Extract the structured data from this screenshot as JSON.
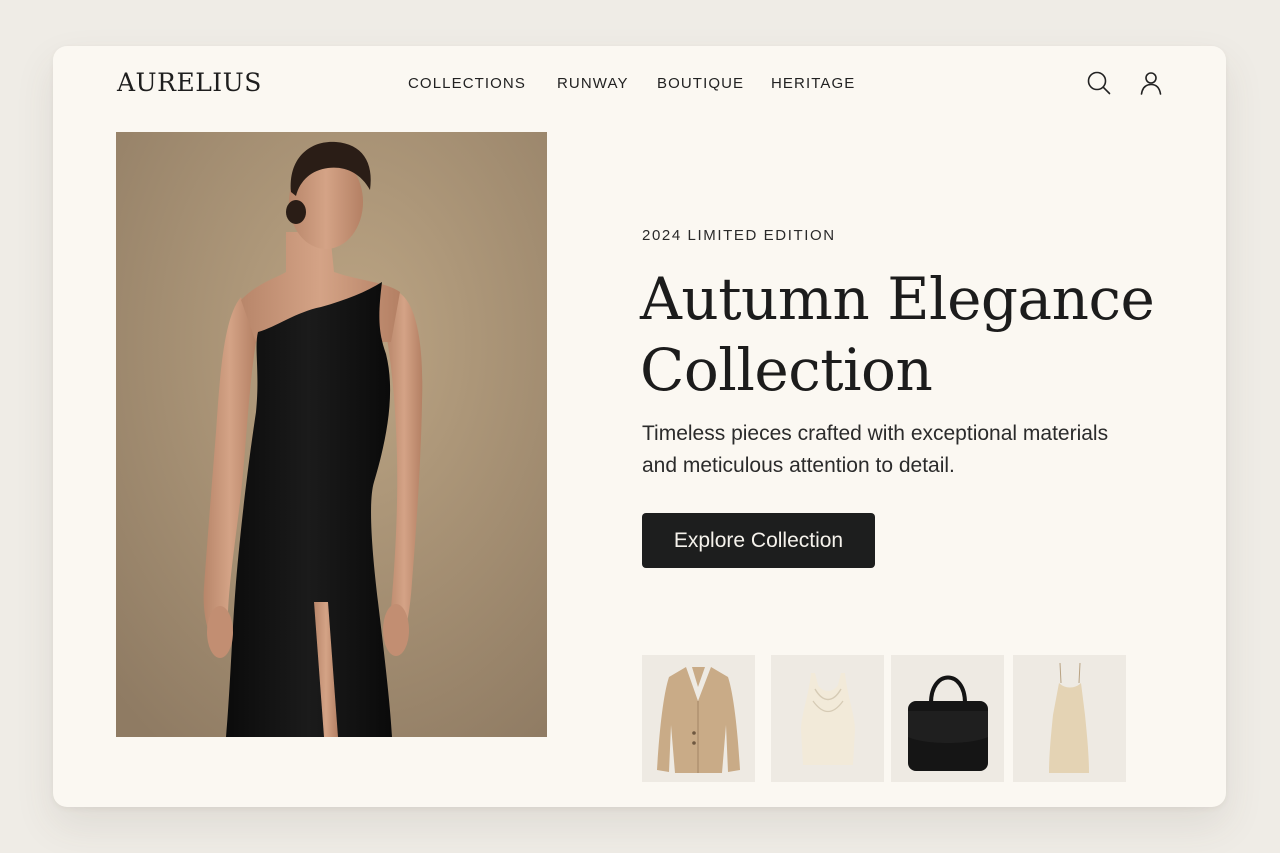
{
  "brand": {
    "name": "AURELIUS"
  },
  "nav": {
    "items": [
      {
        "label": "COLLECTIONS"
      },
      {
        "label": "RUNWAY"
      },
      {
        "label": "BOUTIQUE"
      },
      {
        "label": "HERITAGE"
      }
    ],
    "icons": [
      "search-icon",
      "user-icon"
    ]
  },
  "hero": {
    "eyebrow": "2024 LIMITED EDITION",
    "title_line1": "Autumn Elegance",
    "title_line2": "Collection",
    "description": "Timeless pieces crafted with exceptional materials and meticulous attention to detail.",
    "cta_label": "Explore Collection",
    "image": "model-in-black-one-shoulder-gown"
  },
  "products": [
    {
      "item": "camel-blazer"
    },
    {
      "item": "ivory-cowl-neck-top"
    },
    {
      "item": "black-handbag"
    },
    {
      "item": "champagne-slip-dress"
    }
  ],
  "colors": {
    "background": "#efece6",
    "card": "#fbf8f2",
    "text": "#1c1c1c",
    "cta": "#1d1e1e",
    "photo_backdrop": "#a68f71"
  }
}
